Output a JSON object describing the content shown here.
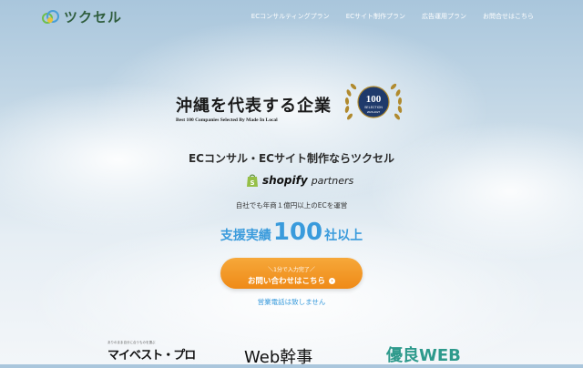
{
  "header": {
    "logo_text": "ツクセル",
    "nav": [
      {
        "label": "ECコンサルティングプラン"
      },
      {
        "label": "ECサイト制作プラン"
      },
      {
        "label": "広告運用プラン"
      },
      {
        "label": "お問合せはこちら"
      }
    ]
  },
  "hero": {
    "headline_jp": "沖縄を代表する企業",
    "headline_en": "Best 100 Companies Selected By Made In Local",
    "badge_number": "100",
    "badge_label": "SELECTION",
    "badge_years": "2026-2027",
    "tagline": "ECコンサル・ECサイト制作ならツクセル",
    "shopify_word": "shopify",
    "shopify_partners": "partners",
    "sub": "自社でも年商１億円以上のECを運営",
    "record_prefix": "支援実績",
    "record_number": "100",
    "record_suffix": "社以上",
    "cta_small": "＼1分で入力完了／",
    "cta_main": "お問い合わせはこちら",
    "note": "営業電話は致しません"
  },
  "logos": {
    "mybest_small": "ありのまま自分に合うものを選ぶ",
    "mybest_main": "マイベスト・プロ",
    "webkanji": "Web幹事",
    "yuryo": "優良WEB"
  },
  "colors": {
    "accent_blue": "#3a9bdc",
    "cta_orange": "#ef8a17",
    "logo_green": "#2f5d3d"
  }
}
